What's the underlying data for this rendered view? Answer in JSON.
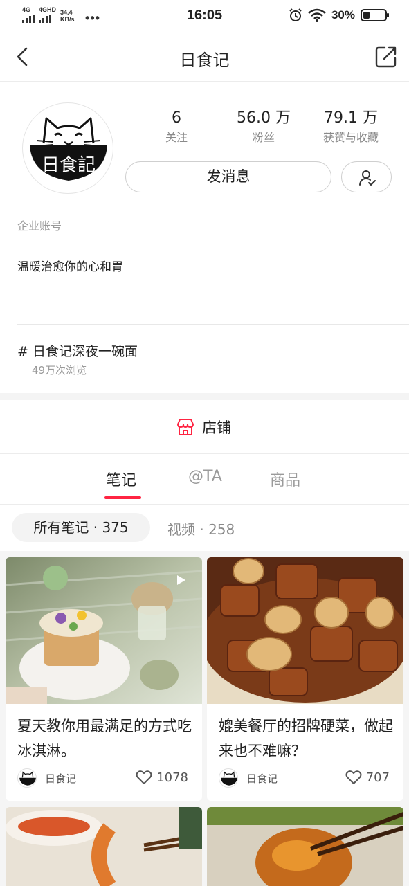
{
  "status_bar": {
    "sim1": "4G",
    "sim2": "4GHD",
    "speed": "34.4",
    "speed_unit": "KB/s",
    "more": "•••",
    "time": "16:05",
    "battery": "30%",
    "battery_level": 0.3
  },
  "nav": {
    "title": "日食记"
  },
  "profile": {
    "stats": [
      {
        "value": "6",
        "label": "关注"
      },
      {
        "value": "56.0 万",
        "label": "粉丝"
      },
      {
        "value": "79.1 万",
        "label": "获赞与收藏"
      }
    ],
    "message_button": "发消息",
    "account_type": "企业账号",
    "bio": "温暖治愈你的心和胃",
    "topic": "# 日食记深夜一碗面",
    "topic_views": "49万次浏览"
  },
  "store": {
    "label": "店铺"
  },
  "tabs": [
    {
      "label": "笔记",
      "active": true
    },
    {
      "label": "@TA",
      "active": false
    },
    {
      "label": "商品",
      "active": false
    }
  ],
  "filters": {
    "all_notes": "所有笔记 · 375",
    "videos": "视频 · 258"
  },
  "cards": [
    {
      "title": "夏天教你用最满足的方式吃冰淇淋。",
      "author": "日食记",
      "likes": "1078",
      "is_video": true
    },
    {
      "title": "媲美餐厅的招牌硬菜，做起来也不难嘛？",
      "author": "日食记",
      "likes": "707",
      "is_video": false
    }
  ],
  "colors": {
    "accent": "#ff2442",
    "chip_bg": "#f3f3f3",
    "feed_bg": "#f5f5f5"
  }
}
